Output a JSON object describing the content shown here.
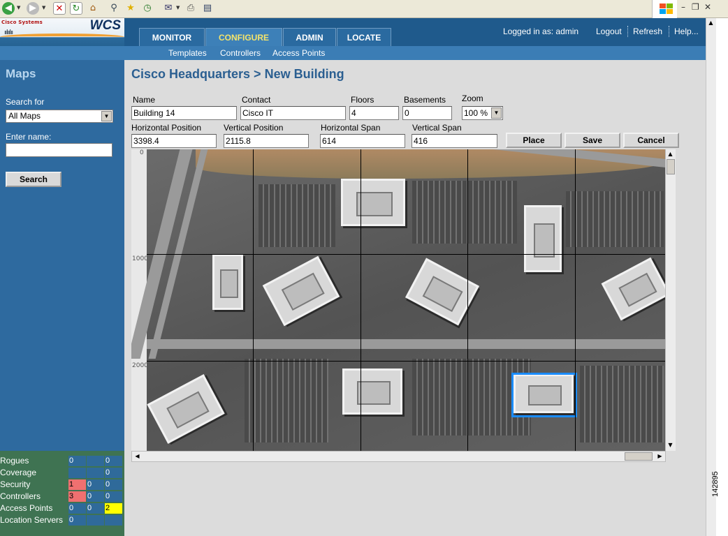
{
  "browser": {
    "toolbar_icons": [
      "back-icon",
      "forward-icon",
      "stop-icon",
      "refresh-icon",
      "home-icon",
      "search-icon",
      "favorites-icon",
      "history-icon",
      "mail-icon",
      "print-icon",
      "edit-icon"
    ]
  },
  "header": {
    "logo_company": "Cisco Systems",
    "logo_product": "WCS",
    "tabs": [
      {
        "label": "MONITOR"
      },
      {
        "label": "CONFIGURE"
      },
      {
        "label": "ADMIN"
      },
      {
        "label": "LOCATE"
      }
    ],
    "subnav": [
      {
        "label": "Templates"
      },
      {
        "label": "Controllers"
      },
      {
        "label": "Access Points"
      }
    ],
    "logged_in": "Logged in as: admin",
    "logout": "Logout",
    "refresh": "Refresh",
    "help": "Help..."
  },
  "sidebar": {
    "title": "Maps",
    "search_for_label": "Search for",
    "search_for_value": "All Maps",
    "enter_name_label": "Enter name:",
    "enter_name_value": "",
    "search_button": "Search"
  },
  "alarms": {
    "rows": [
      {
        "label": "Rogues",
        "c1": "0",
        "c2": "",
        "c3": "0"
      },
      {
        "label": "Coverage",
        "c1": "",
        "c2": "",
        "c3": "0"
      },
      {
        "label": "Security",
        "c1": "1",
        "c2": "0",
        "c3": "0"
      },
      {
        "label": "Controllers",
        "c1": "3",
        "c2": "0",
        "c3": "0"
      },
      {
        "label": "Access Points",
        "c1": "0",
        "c2": "0",
        "c3": "2"
      },
      {
        "label": "Location Servers",
        "c1": "0",
        "c2": "",
        "c3": ""
      }
    ]
  },
  "main": {
    "title": "Cisco Headquarters > New Building",
    "fields": {
      "name_label": "Name",
      "name_value": "Building 14",
      "contact_label": "Contact",
      "contact_value": "Cisco IT",
      "floors_label": "Floors",
      "floors_value": "4",
      "basements_label": "Basements",
      "basements_value": "0",
      "zoom_label": "Zoom",
      "zoom_value": "100 %",
      "hpos_label": "Horizontal Position",
      "hpos_value": "3398.4",
      "vpos_label": "Vertical Position",
      "vpos_value": "2115.8",
      "hspan_label": "Horizontal Span",
      "hspan_value": "614",
      "vspan_label": "Vertical Span",
      "vspan_value": "416"
    },
    "buttons": {
      "place": "Place",
      "save": "Save",
      "cancel": "Cancel"
    },
    "ruler_ticks": [
      "0",
      "1000",
      "2000"
    ]
  },
  "figure_number": "142895",
  "colors": {
    "header_bg": "#1f5a8c",
    "sidebar_bg": "#2e6a9f",
    "alarm_bg": "#3f7352",
    "active_tab_text": "#f5e46b",
    "selection_border": "#1a8cff"
  }
}
